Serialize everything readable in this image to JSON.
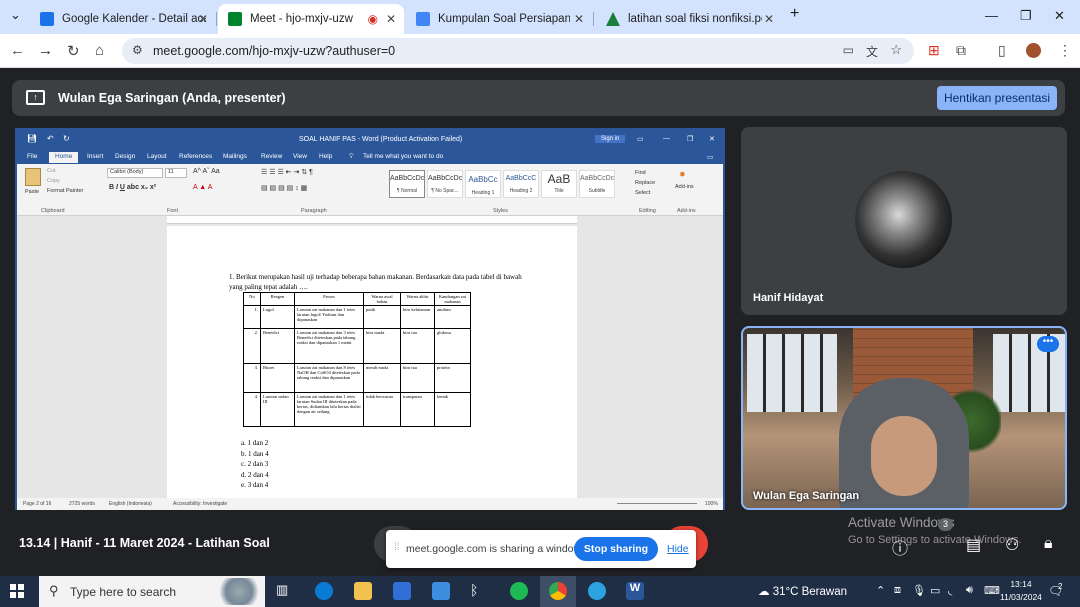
{
  "browser": {
    "tabs": [
      {
        "label": "Google Kalender - Detail acara",
        "color": "#1a73e8"
      },
      {
        "label": "Meet - hjo-mxjv-uzw",
        "color": "#00832d"
      },
      {
        "label": "Kumpulan Soal Persiapan Ujian",
        "color": "#4285f4"
      },
      {
        "label": "latihan soal fiksi nonfiksi.pdf - G",
        "color": "#188038"
      }
    ],
    "url": "meet.google.com/hjo-mxjv-uzw?authuser=0"
  },
  "presenter": {
    "name": "Wulan Ega Saringan (Anda, presenter)",
    "stop_label": "Hentikan presentasi"
  },
  "word": {
    "title": "SOAL HANIF PAS  -  Word (Product Activation Failed)",
    "signin": "Sign in",
    "tell_me": "Tell me what you want to do",
    "menu": [
      "File",
      "Home",
      "Insert",
      "Design",
      "Layout",
      "References",
      "Mailings",
      "Review",
      "View",
      "Help"
    ],
    "font_name": "Calibri (Body)",
    "font_size": "11",
    "clipboard": {
      "paste": "Paste",
      "cut": "Cut",
      "copy": "Copy",
      "format_painter": "Format Painter"
    },
    "styles": [
      {
        "sample": "AaBbCcDc",
        "name": "¶ Normal"
      },
      {
        "sample": "AaBbCcDc",
        "name": "¶ No Spac..."
      },
      {
        "sample": "AaBbCc",
        "name": "Heading 1"
      },
      {
        "sample": "AaBbCcC",
        "name": "Heading 2"
      },
      {
        "sample": "AaB",
        "name": "Title"
      },
      {
        "sample": "AaBbCcDc",
        "name": "Subtitle"
      }
    ],
    "editing": [
      "Find",
      "Replace",
      "Select"
    ],
    "addin": "Add-ins",
    "group_labels": [
      "Clipboard",
      "Font",
      "Paragraph",
      "Styles",
      "Editing",
      "Add-ins"
    ],
    "question": "1.   Berikut merupakan hasil uji terhadap beberapa bahan makanan. Berdasarkan data pada tabel di bawah yang paling tepat adalah ….",
    "table_header": [
      "No",
      "Reagen",
      "Proses",
      "Warna awal bahan",
      "Warna akhir",
      "Kandungan zat makanan"
    ],
    "table_rows": [
      [
        "1.",
        "Lugol",
        "Larutan zat makanan dan 1 tetes larutan lugol/ Yodium dan dipanaskan",
        "putih",
        "biru kehitaman",
        "amilum"
      ],
      [
        "2.",
        "Benedict",
        "Larutan zat makanan dan 3 tetes Benedict diteteskan pada tabung reaksi dan dipanaskan 1 menit",
        "biru muda",
        "biru tua",
        "glukosa"
      ],
      [
        "3.",
        "Biuret",
        "Larutan zat makanan dan 8 tetes NaOH dan CuSO4 diteteskan pada tabung reaksi dan dipanaskan",
        "merah muda",
        "biru tua",
        "protein"
      ],
      [
        "4.",
        "Larutan sudan III",
        "Larutan zat makanan dan 1 tetes larutan Sudan III diteteskan pada kertas, didiamkan lalu kertas dialiri dengan air sedang",
        "tidak berwarna",
        "transparan",
        "lemak"
      ]
    ],
    "options": [
      "a. 1 dan 2",
      "b. 1 dan 4",
      "c. 2 dan 3",
      "d. 2 dan 4",
      "e. 3 dan 4"
    ],
    "status": {
      "page": "Page 2 of 16",
      "words": "2725 words",
      "lang": "English (Indonesia)",
      "access": "Accessibility: Investigate",
      "zoom": "100%"
    }
  },
  "participants": [
    {
      "name": "Hanif Hidayat"
    },
    {
      "name": "Wulan Ega Saringan"
    }
  ],
  "meeting": {
    "label": "13.14   |   Hanif - 11 Maret 2024 - Latihan Soal"
  },
  "sharebar": {
    "message": "meet.google.com is sharing a window.",
    "stop": "Stop sharing",
    "hide": "Hide"
  },
  "windows_watermark": {
    "line1": "Activate Windows",
    "line2": "Go to Settings to activate Windows."
  },
  "badge_count": "3",
  "taskbar": {
    "search_placeholder": "Type here to search",
    "weather": "31°C  Berawan",
    "time": "13:14",
    "date": "11/03/2024",
    "notif": "2"
  }
}
